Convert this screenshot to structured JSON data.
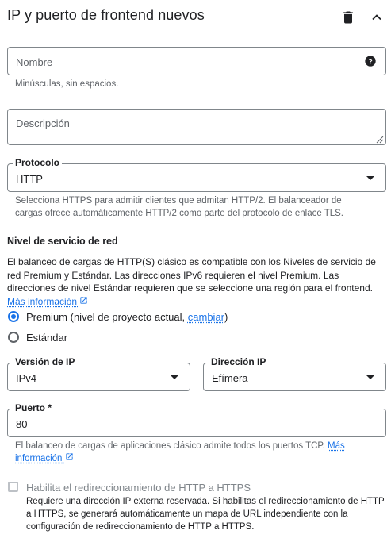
{
  "header": {
    "title": "IP y puerto de frontend nuevos",
    "delete_icon": "trash-icon",
    "collapse_icon": "chevron-up-icon"
  },
  "name_field": {
    "placeholder": "Nombre",
    "help_icon": "help-circle-icon",
    "hint": "Minúsculas, sin espacios."
  },
  "description_field": {
    "placeholder": "Descripción"
  },
  "protocol": {
    "label": "Protocolo",
    "value": "HTTP",
    "hint": "Selecciona HTTPS para admitir clientes que admitan HTTP/2. El balanceador de cargas ofrece automáticamente HTTP/2 como parte del protocolo de enlace TLS."
  },
  "network_tier": {
    "heading": "Nivel de servicio de red",
    "text": "El balanceo de cargas de HTTP(S) clásico es compatible con los Niveles de servicio de red Premium y Estándar. Las direcciones IPv6 requieren el nivel Premium. Las direcciones de nivel Estándar requieren que se seleccione una región para el frontend.",
    "more_link": "Más información",
    "options": [
      {
        "label": "Premium (nivel de proyecto actual, ",
        "link": "cambiar",
        "suffix": ")",
        "selected": true
      },
      {
        "label": "Estándar",
        "selected": false
      }
    ]
  },
  "ip_version": {
    "label": "Versión de IP",
    "value": "IPv4"
  },
  "ip_address": {
    "label": "Dirección IP",
    "value": "Efímera"
  },
  "port": {
    "label": "Puerto *",
    "value": "80",
    "hint": "El balanceo de cargas de aplicaciones clásico admite todos los puertos TCP.",
    "more_link": "Más información"
  },
  "redirect": {
    "label": "Habilita el redireccionamiento de HTTP a HTTPS",
    "description": "Requiere una dirección IP externa reservada. Si habilitas el redireccionamiento de HTTP a HTTPS, se generará automáticamente un mapa de URL independiente con la configuración de redireccionamiento de HTTP a HTTPS.",
    "checked": false
  },
  "colors": {
    "accent": "#1a73e8",
    "text": "#202124",
    "secondary": "#5f6368",
    "border": "#80868b"
  }
}
